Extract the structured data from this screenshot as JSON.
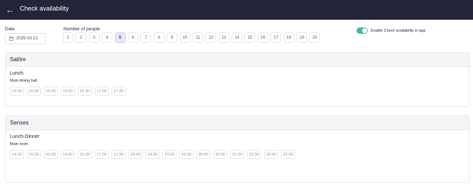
{
  "header": {
    "back_icon": "arrow-left-icon",
    "title": "Check availability"
  },
  "date": {
    "label": "Date",
    "value": "2025-03-21",
    "icon": "calendar-icon"
  },
  "people": {
    "label": "Number of people",
    "options": [
      "1",
      "2",
      "3",
      "4",
      "5",
      "6",
      "7",
      "8",
      "9",
      "10",
      "11",
      "12",
      "13",
      "14",
      "15",
      "16",
      "17",
      "18",
      "19",
      "20"
    ],
    "selected": "5"
  },
  "toggle": {
    "label": "Enable Check availability in app",
    "on": true,
    "color": "#45b7a8"
  },
  "sections": [
    {
      "name": "Salitre",
      "meal": "Lunch",
      "room": "Main dining hall",
      "slots": [
        "14:30",
        "15:00",
        "15:30",
        "16:00",
        "16:30",
        "17:00",
        "17:30"
      ]
    },
    {
      "name": "Senses",
      "meal": "Lunch-Dinner",
      "room": "Main room",
      "slots": [
        "14:30",
        "15:00",
        "15:30",
        "14:00",
        "16:30",
        "17:00",
        "17:30",
        "18:00",
        "18:30",
        "19:00",
        "19:30",
        "20:00",
        "20:30",
        "21:00",
        "21:30",
        "22:00",
        "22:30"
      ]
    }
  ]
}
